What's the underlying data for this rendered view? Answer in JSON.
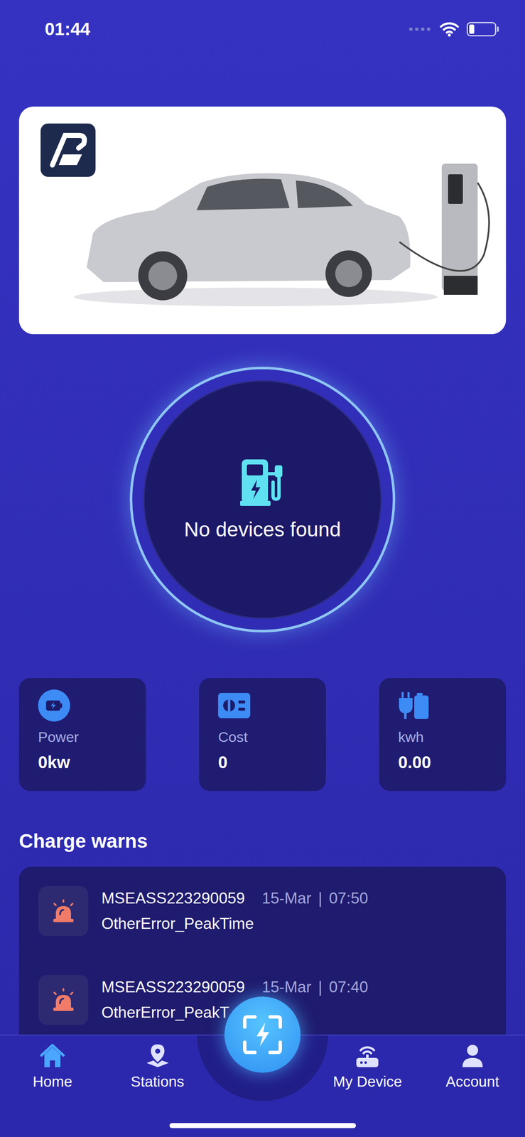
{
  "status_bar": {
    "time": "01:44",
    "battery_level": 0.2
  },
  "device": {
    "message": "No devices found"
  },
  "stats": [
    {
      "label": "Power",
      "value": "0kw",
      "kind": "power"
    },
    {
      "label": "Cost",
      "value": "0",
      "kind": "cost"
    },
    {
      "label": "kwh",
      "value": "0.00",
      "kind": "energy"
    }
  ],
  "charge_warns": {
    "title": "Charge warns",
    "items": [
      {
        "device": "MSEASS223290059",
        "date": "15-Mar",
        "separator": "|",
        "time": "07:50",
        "error": "OtherError_PeakTime"
      },
      {
        "device": "MSEASS223290059",
        "date": "15-Mar",
        "separator": "|",
        "time": "07:40",
        "error": "OtherError_PeakT"
      }
    ]
  },
  "nav": [
    {
      "label": "Home",
      "kind": "home",
      "selected": true
    },
    {
      "label": "Stations",
      "kind": "stations",
      "selected": false
    },
    {
      "label": "My Device",
      "kind": "device",
      "selected": false
    },
    {
      "label": "Account",
      "kind": "account",
      "selected": false
    }
  ]
}
